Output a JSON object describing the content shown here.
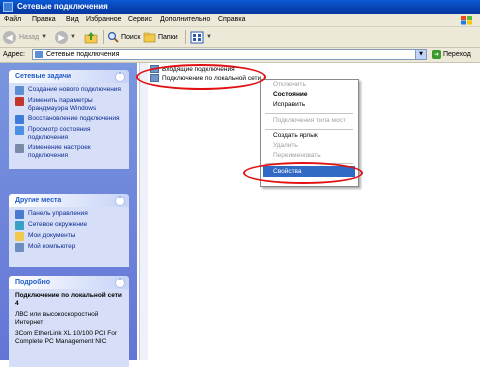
{
  "window": {
    "title": "Сетевые подключения"
  },
  "menu": [
    "Файл",
    "Правка",
    "Вид",
    "Избранное",
    "Сервис",
    "Дополнительно",
    "Справка"
  ],
  "toolbar": {
    "back": "Назад",
    "search": "Поиск",
    "folders": "Папки"
  },
  "address": {
    "label": "Адрес:",
    "value": "Сетевые подключения",
    "go": "Переход"
  },
  "sidebar": {
    "network_tasks": {
      "title": "Сетевые задачи",
      "items": [
        "Создание нового подключения",
        "Изменить параметры брандмауэра Windows",
        "Восстановление подключения",
        "Просмотр состояния подключения",
        "Изменение настроек подключения"
      ]
    },
    "other_places": {
      "title": "Другие места",
      "items": [
        "Панель управления",
        "Сетевое окружение",
        "Мои документы",
        "Мой компьютер"
      ]
    },
    "details": {
      "title": "Подробно",
      "name": "Подключение по локальной сети 4",
      "type": "ЛВС или высокоскоростной Интернет",
      "device": "3Com EtherLink XL 10/100 PCI For Complete PC Management NIC"
    }
  },
  "content": {
    "items": [
      "Входящие подключения",
      "Подключение по локальной сети"
    ]
  },
  "context_menu": {
    "disable": "Отключить",
    "status": "Состояние",
    "repair": "Исправить",
    "bridge": "Подключения типа мост",
    "shortcut": "Создать ярлык",
    "delete": "Удалить",
    "rename": "Переименовать",
    "properties": "Свойства"
  },
  "colors": {
    "titlebar": "#0842b0",
    "sidebar": "#6e85da",
    "highlight": "#316ac5",
    "annotation": "#e01010"
  }
}
